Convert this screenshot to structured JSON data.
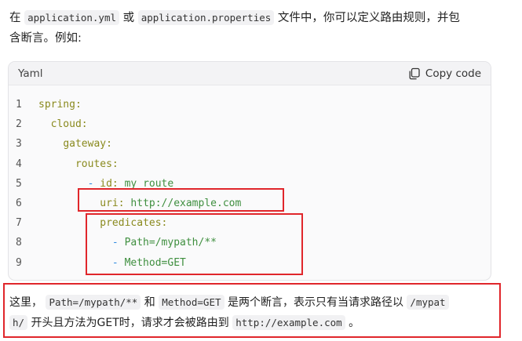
{
  "intro": {
    "pre": "在",
    "file1": "application.yml",
    "or": "或",
    "file2": "application.properties",
    "post": "文件中，你可以定义路由规则，并包",
    "line2": "含断言。例如:"
  },
  "code_block": {
    "language": "Yaml",
    "copy_label": "Copy code",
    "lines": [
      {
        "n": "1",
        "indent": "",
        "key": "spring:",
        "value": ""
      },
      {
        "n": "2",
        "indent": "  ",
        "key": "cloud:",
        "value": ""
      },
      {
        "n": "3",
        "indent": "    ",
        "key": "gateway:",
        "value": ""
      },
      {
        "n": "4",
        "indent": "      ",
        "key": "routes:",
        "value": ""
      },
      {
        "n": "5",
        "indent": "        ",
        "dash": "- ",
        "key": "id:",
        "value": " my_route"
      },
      {
        "n": "6",
        "indent": "          ",
        "key": "uri:",
        "value": " http://example.com"
      },
      {
        "n": "7",
        "indent": "          ",
        "key": "predicates:",
        "value": ""
      },
      {
        "n": "8",
        "indent": "            ",
        "dash": "- ",
        "key": "",
        "value": "Path=/mypath/**"
      },
      {
        "n": "9",
        "indent": "            ",
        "dash": "- ",
        "key": "",
        "value": "Method=GET"
      }
    ]
  },
  "note": {
    "a": "这里，",
    "c1": "Path=/mypath/**",
    "and": "和",
    "c2": "Method=GET",
    "b": "是两个断言，表示只有当请求路径以",
    "c3a": "/mypat",
    "c3b": "h/",
    "c": "开头且方法为GET时，请求才会被路由到",
    "c4": "http://example.com",
    "end": "。"
  },
  "colors": {
    "highlight": "#e0262b",
    "yaml_key": "#8a8a1e",
    "yaml_value": "#3f8f3f",
    "yaml_dash": "#2f8ae0"
  },
  "icons": {
    "copy": "copy-icon"
  }
}
